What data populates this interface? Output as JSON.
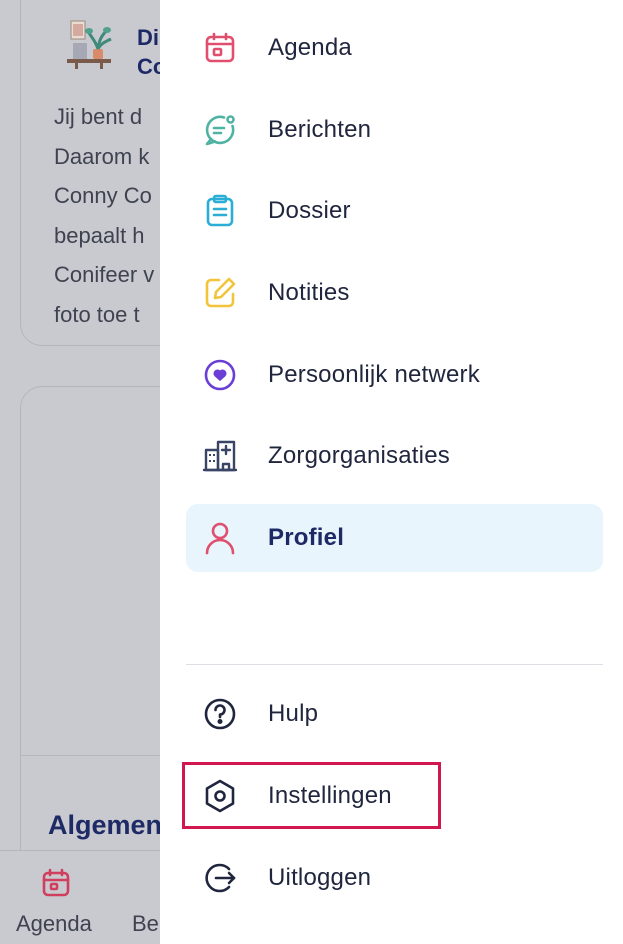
{
  "background": {
    "card": {
      "title": "Di\nCo",
      "text": "Jij bent d\nDaarom k\nConny Co\nbepaalt h\nConifeer v\nfoto toe t"
    },
    "section_title": "Algemen",
    "tabbar": [
      {
        "label": "Agenda",
        "icon": "calendar-icon"
      },
      {
        "label": "Be"
      }
    ]
  },
  "drawer": {
    "items": [
      {
        "label": "Agenda",
        "icon": "calendar-icon",
        "color": "#e0506e"
      },
      {
        "label": "Berichten",
        "icon": "chat-bubble-icon",
        "color": "#4fb3a3"
      },
      {
        "label": "Dossier",
        "icon": "clipboard-icon",
        "color": "#2aaed6"
      },
      {
        "label": "Notities",
        "icon": "edit-note-icon",
        "color": "#f2c43a"
      },
      {
        "label": "Persoonlijk netwerk",
        "icon": "heart-pin-icon",
        "color": "#6b3fd6"
      },
      {
        "label": "Zorgorganisaties",
        "icon": "hospital-building-icon",
        "color": "#3a4466"
      },
      {
        "label": "Profiel",
        "icon": "user-icon",
        "color": "#e0506e",
        "active": true
      }
    ],
    "footer_items": [
      {
        "label": "Hulp",
        "icon": "help-circle-icon"
      },
      {
        "label": "Instellingen",
        "icon": "settings-hexagon-icon",
        "highlighted": true
      },
      {
        "label": "Uitloggen",
        "icon": "logout-icon"
      }
    ]
  },
  "colors": {
    "active_bg": "#e8f5fc",
    "highlight_border": "#d2164f",
    "text_dark": "#20263e",
    "title_navy": "#1e2a66"
  }
}
